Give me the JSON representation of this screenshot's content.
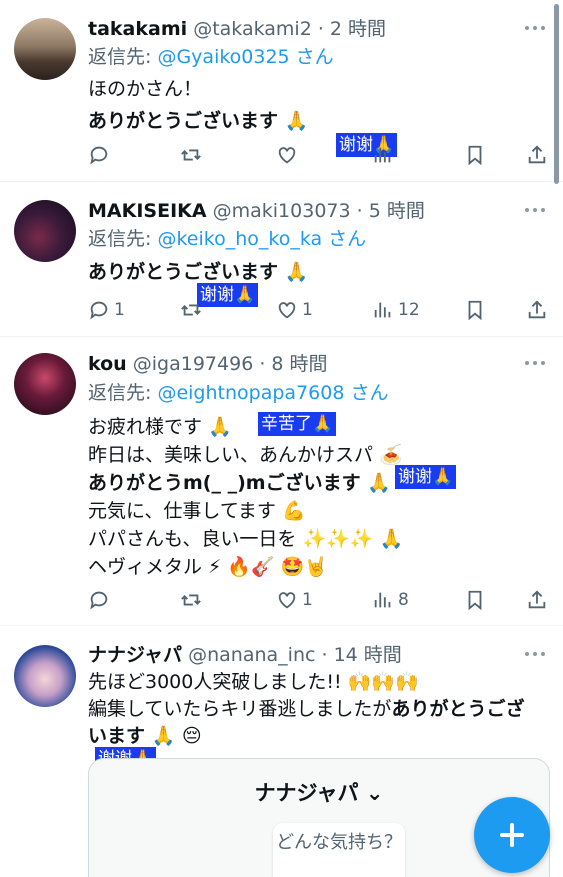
{
  "posts": [
    {
      "name": "takakami",
      "handle": "@takakami2",
      "time": "· 2 時間",
      "reply_prefix": "返信先:",
      "reply_to": "@Gyaiko0325 さん",
      "lines": [
        "ほのかさん！",
        "ありがとうございます 🙏"
      ],
      "translation": "谢谢🙏",
      "actions": {
        "reply": "",
        "repost": "",
        "like": "",
        "views": ""
      }
    },
    {
      "name": "MAKISEIKA",
      "handle": "@maki103073",
      "time": "· 5 時間",
      "reply_prefix": "返信先:",
      "reply_to": "@keiko_ho_ko_ka さん",
      "lines": [
        "ありがとうございます 🙏"
      ],
      "translation": "谢谢🙏",
      "actions": {
        "reply": "1",
        "repost": "",
        "like": "1",
        "views": "12"
      }
    },
    {
      "name": "kou",
      "handle": "@iga197496",
      "time": "· 8 時間",
      "reply_prefix": "返信先:",
      "reply_to": "@eightnopapa7608 さん",
      "lines": [
        "お疲れ様です 🙏",
        "昨日は、美味しい、あんかけスパ 🍝",
        "ありがとうm(_ _)mございます 🙏",
        "元気に、仕事してます 💪",
        "パパさんも、良い一日を ✨✨✨ 🙏",
        "ヘヴィメタル ⚡ 🔥🎸 🤩🤘"
      ],
      "translation_1": "辛苦了🙏",
      "translation_2": "谢谢🙏",
      "actions": {
        "reply": "",
        "repost": "",
        "like": "1",
        "views": "8"
      }
    },
    {
      "name": "ナナジャパ",
      "handle": "@nanana_inc",
      "time": "· 14 時間",
      "lines": [
        "先ほど3000人突破しました!! 🙌🙌🙌",
        "編集していたらキリ番逃しましたが",
        "ありがとうござ",
        "います 🙏 😔"
      ],
      "translation": "谢谢🙏",
      "card": {
        "title": "ナナジャパ ⌄",
        "pill": "どんな気持ち？"
      }
    }
  ]
}
